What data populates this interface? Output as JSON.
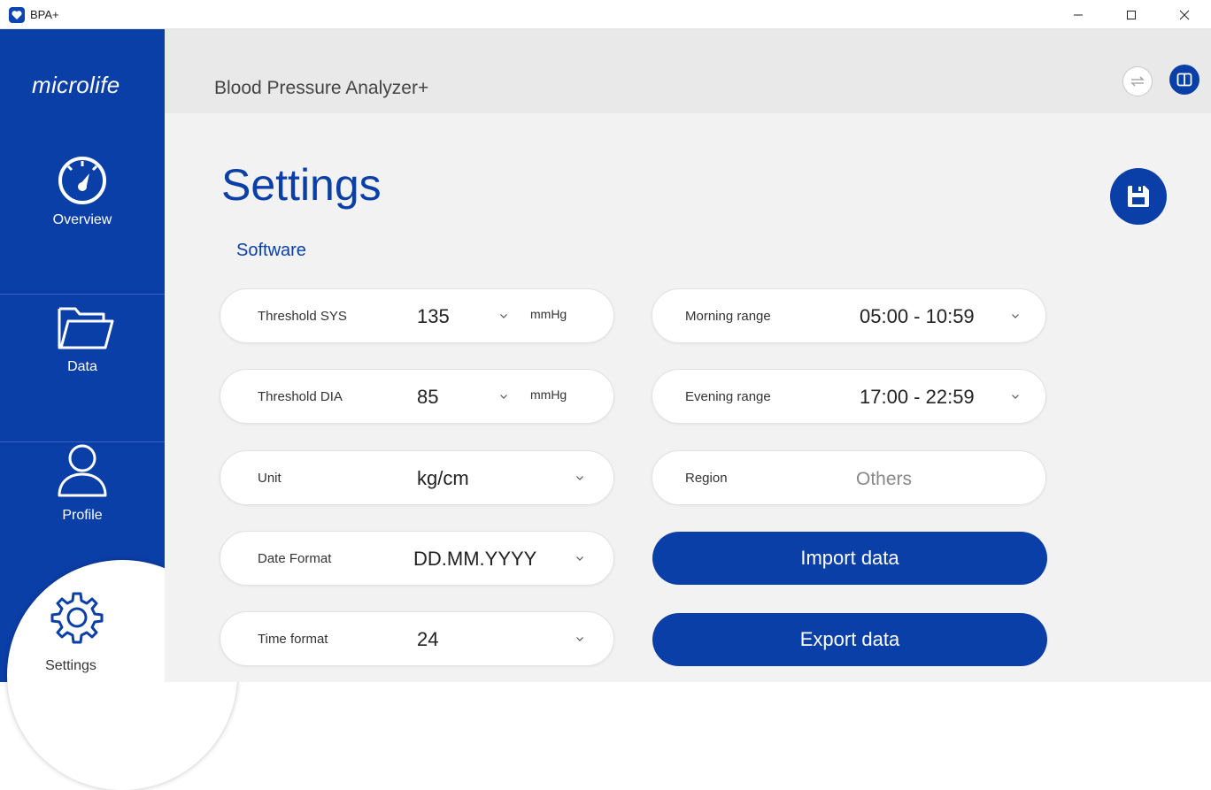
{
  "window": {
    "title": "BPA+"
  },
  "sidebar": {
    "logo": "microlife",
    "items": [
      {
        "label": "Overview",
        "icon": "gauge-icon"
      },
      {
        "label": "Data",
        "icon": "folder-icon"
      },
      {
        "label": "Profile",
        "icon": "person-icon"
      },
      {
        "label": "Settings",
        "icon": "gear-icon",
        "active": true
      }
    ]
  },
  "header": {
    "app_title": "Blood Pressure Analyzer+",
    "buttons": [
      "sync-icon",
      "manual-icon"
    ]
  },
  "page": {
    "title": "Settings",
    "section": "Software",
    "save_icon": "save-icon"
  },
  "fields_left": [
    {
      "label": "Threshold SYS",
      "value": "135",
      "unit": "mmHg"
    },
    {
      "label": "Threshold DIA",
      "value": "85",
      "unit": "mmHg"
    },
    {
      "label": "Unit",
      "value": "kg/cm"
    },
    {
      "label": "Date Format",
      "value": "DD.MM.YYYY"
    },
    {
      "label": "Time format",
      "value": "24"
    }
  ],
  "fields_right": [
    {
      "label": "Morning range",
      "value": "05:00 - 10:59"
    },
    {
      "label": "Evening range",
      "value": "17:00 - 22:59"
    },
    {
      "label": "Region",
      "value": "Others"
    }
  ],
  "actions": {
    "import": "Import data",
    "export": "Export data"
  },
  "colors": {
    "brand": "#0b3fa8",
    "background": "#f2f2f2"
  }
}
